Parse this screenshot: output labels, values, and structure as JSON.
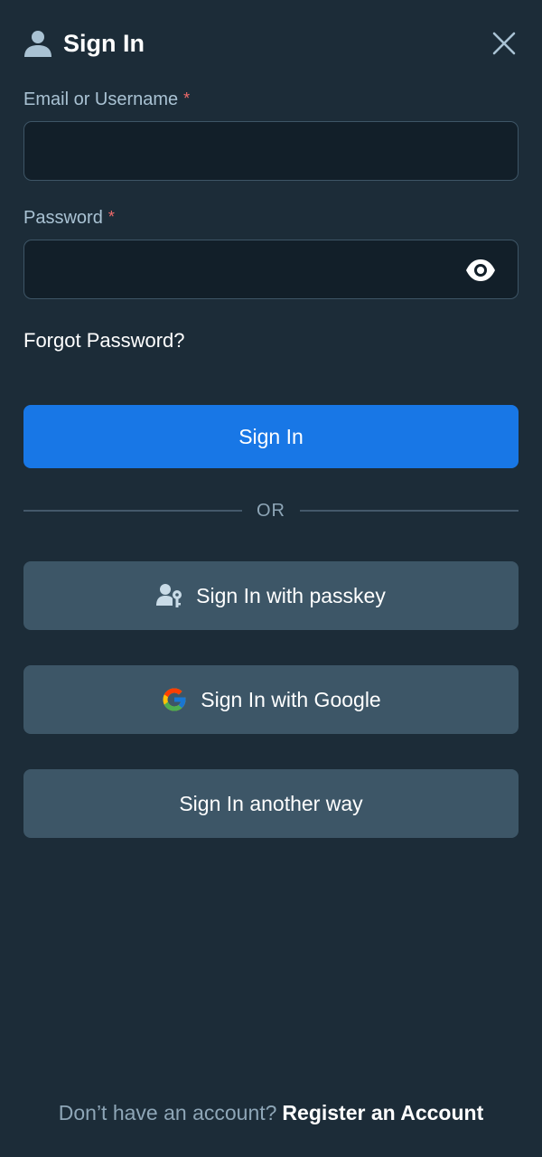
{
  "header": {
    "title": "Sign In",
    "icon": "user-icon",
    "close_icon": "close-icon"
  },
  "form": {
    "email_label": "Email or Username",
    "password_label": "Password",
    "required_mark": "*",
    "email_value": "",
    "password_value": "",
    "forgot_label": "Forgot Password?"
  },
  "actions": {
    "sign_in_label": "Sign In",
    "divider_label": "OR",
    "passkey_label": "Sign In with passkey",
    "google_label": "Sign In with Google",
    "another_way_label": "Sign In another way"
  },
  "footer": {
    "prompt": "Don’t have an account?",
    "register_label": "Register an Account"
  },
  "colors": {
    "background": "#1c2c38",
    "primary": "#1877e6",
    "secondary": "#3d5667",
    "required": "#f06a6a"
  }
}
